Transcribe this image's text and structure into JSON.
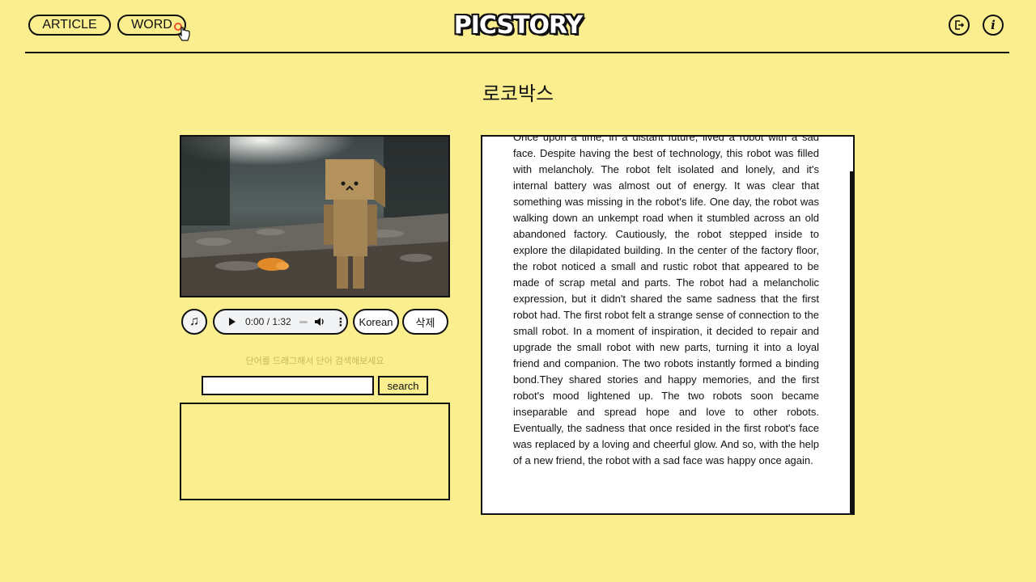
{
  "header": {
    "nav": {
      "article_label": "ARTICLE",
      "word_label": "WORD"
    },
    "logo": "PICSTORY",
    "icons": [
      "logout-icon",
      "info-icon"
    ],
    "info_glyph": "i"
  },
  "page": {
    "title": "로코박스"
  },
  "player": {
    "music_icon": "♫",
    "time": "0:00 / 1:32",
    "progress": 0,
    "more_icon": "⋮",
    "korean_label": "Korean",
    "delete_label": "삭제"
  },
  "search": {
    "hint": "단어를 드래그해서 단어 검색해보세요",
    "input_value": "",
    "button_label": "search"
  },
  "story": {
    "text": "Once upon a time, in a distant future, lived a robot with a sad face. Despite having the best of technology, this robot was filled with melancholy. The robot felt isolated and lonely, and it's internal battery was almost out of energy. It was clear that something was missing in the robot's life. One day, the robot was walking down an unkempt road when it stumbled across an old abandoned factory. Cautiously, the robot stepped inside to explore the dilapidated building. In the center of the factory floor, the robot noticed a small and rustic robot that appeared to be made of scrap metal and parts. The robot had a melancholic expression, but it didn't shared the same sadness that the first robot had. The first robot felt a strange sense of connection to the small robot. In a moment of inspiration, it decided to repair and upgrade the small robot with new parts, turning it into a loyal friend and companion. The two robots instantly formed a binding bond.They shared stories and happy memories, and the first robot's mood lightened up. The two robots soon became inseparable and spread hope and love to other robots. Eventually, the sadness that once resided in the first robot's face was replaced by a loving and cheerful glow. And so, with the help of a new friend, the robot with a sad face was happy once again."
  },
  "colors": {
    "background": "#fbee8f",
    "border": "#111111",
    "panel": "#ffffff"
  }
}
